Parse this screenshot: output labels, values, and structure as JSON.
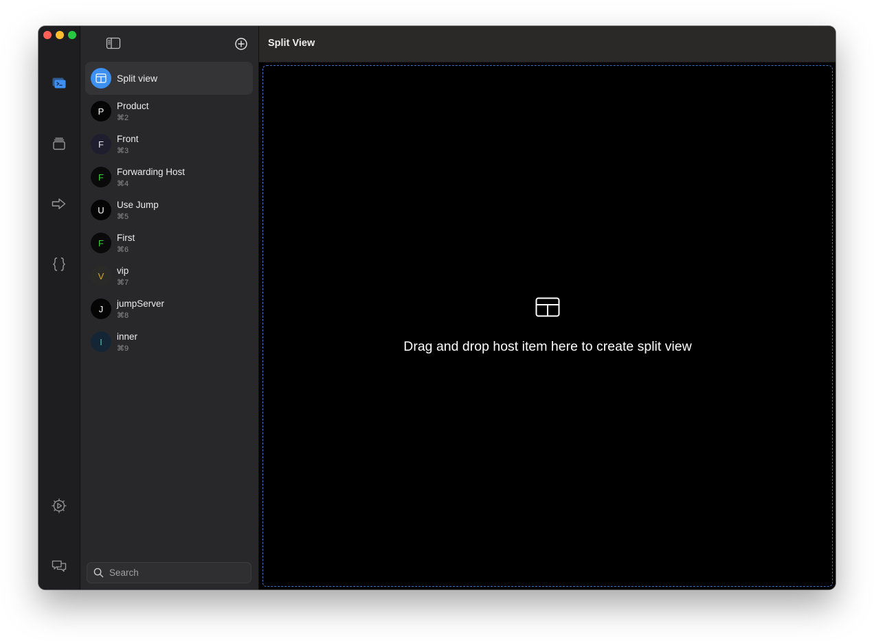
{
  "window": {
    "title": "Split View"
  },
  "rail": {
    "icons": [
      "terminal-icon",
      "stack-icon",
      "forward-arrow-icon",
      "braces-icon",
      "settings-icon",
      "chat-icon"
    ],
    "accent": "#3d8ff0",
    "icon_color": "#9a9a9e"
  },
  "sidebar": {
    "hosts": [
      {
        "label": "Split view",
        "shortcut": "",
        "avatar": "",
        "avatar_bg": "#3d8ff0",
        "avatar_fg": "#ffffff",
        "active": true
      },
      {
        "label": "Product",
        "shortcut": "⌘2",
        "avatar": "P",
        "avatar_bg": "#050505",
        "avatar_fg": "#ffffff"
      },
      {
        "label": "Front",
        "shortcut": "⌘3",
        "avatar": "F",
        "avatar_bg": "#1e1e2e",
        "avatar_fg": "#e6e6f0"
      },
      {
        "label": "Forwarding Host",
        "shortcut": "⌘4",
        "avatar": "F",
        "avatar_bg": "#0a0a0a",
        "avatar_fg": "#3cd23c"
      },
      {
        "label": "Use Jump",
        "shortcut": "⌘5",
        "avatar": "U",
        "avatar_bg": "#050505",
        "avatar_fg": "#ffffff"
      },
      {
        "label": "First",
        "shortcut": "⌘6",
        "avatar": "F",
        "avatar_bg": "#0a0a0a",
        "avatar_fg": "#3cd23c"
      },
      {
        "label": "vip",
        "shortcut": "⌘7",
        "avatar": "V",
        "avatar_bg": "#2a2a28",
        "avatar_fg": "#d6a81e"
      },
      {
        "label": "jumpServer",
        "shortcut": "⌘8",
        "avatar": "J",
        "avatar_bg": "#050505",
        "avatar_fg": "#ffffff"
      },
      {
        "label": "inner",
        "shortcut": "⌘9",
        "avatar": "I",
        "avatar_bg": "#142636",
        "avatar_fg": "#40c8a0"
      }
    ],
    "search_placeholder": "Search"
  },
  "main": {
    "drop_message": "Drag and drop host item here to create split view",
    "drop_border_color": "#3b74c6"
  }
}
